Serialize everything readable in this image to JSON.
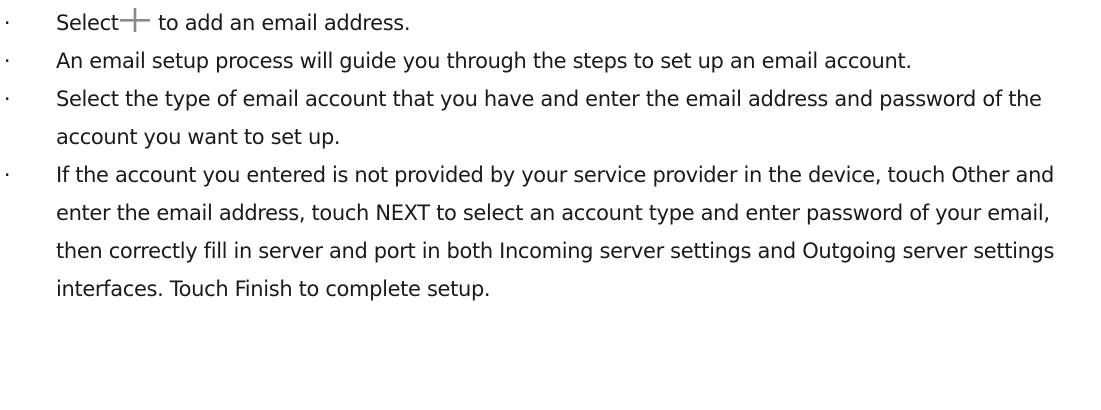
{
  "bullet_char": "·",
  "items": [
    {
      "before_icon": "Select",
      "icon": "plus-icon",
      "after_icon": " to add an email address."
    },
    {
      "text": "An email setup process will guide you through the steps to set up an email account."
    },
    {
      "text": "Select the type of email account that you have and enter the email address and password of the account you want to set up."
    },
    {
      "part1": "If the account you entered is not provided by your service provider in the device, touch ",
      "other": "Other",
      "part2": " and enter the email address, touch ",
      "next": "NEXT",
      "part3": " to select an account type and enter password of your email, then correctly fill in server and port in both Incoming server settings and Outgoing server settings interfaces. Touch ",
      "finish": "Finish",
      "part4": " to complete setup."
    }
  ],
  "colors": {
    "text": "#1a1a1a",
    "icon": "#8a8a8a"
  }
}
